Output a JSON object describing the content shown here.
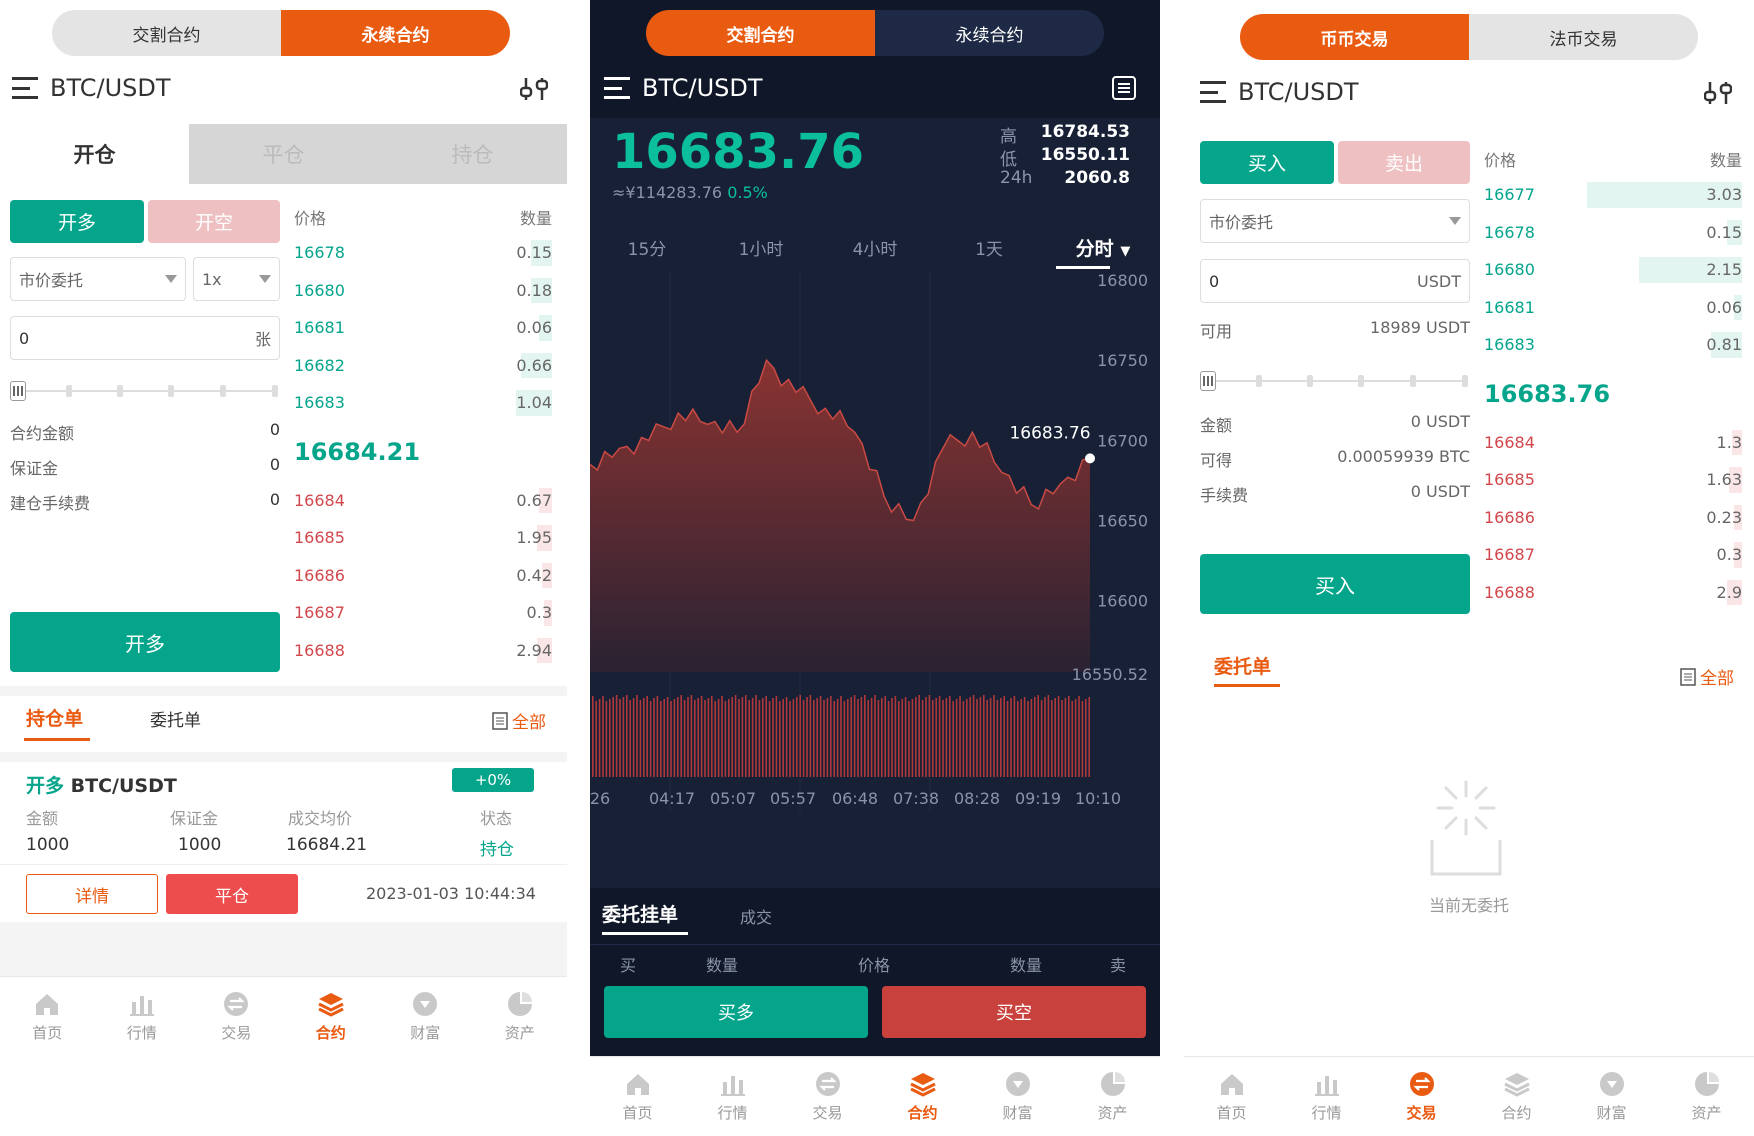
{
  "colors": {
    "accent": "#ea5b12",
    "buy": "#05a58c",
    "sell": "#d2474b",
    "sell_light": "#eec0c2",
    "dark_bg": "#172035",
    "dark_header": "#0f1728"
  },
  "p1": {
    "seg": [
      "交割合约",
      "永续合约"
    ],
    "pair": "BTC/USDT",
    "tabs": [
      "开仓",
      "平仓",
      "持仓"
    ],
    "side": [
      "开多",
      "开空"
    ],
    "order_type": "市价委托",
    "leverage": "1x",
    "qty_value": "0",
    "qty_unit": "张",
    "fields": [
      {
        "k": "合约金额",
        "v": "0"
      },
      {
        "k": "保证金",
        "v": "0"
      },
      {
        "k": "建仓手续费",
        "v": "0"
      }
    ],
    "main_btn": "开多",
    "ob_head": [
      "价格",
      "数量"
    ],
    "asks": [
      {
        "p": "16678",
        "q": "0.15",
        "d": 0.08
      },
      {
        "p": "16680",
        "q": "0.18",
        "d": 0.08
      },
      {
        "p": "16681",
        "q": "0.06",
        "d": 0.05
      },
      {
        "p": "16682",
        "q": "0.66",
        "d": 0.12
      },
      {
        "p": "16683",
        "q": "1.04",
        "d": 0.14
      }
    ],
    "last": "16684.21",
    "bids": [
      {
        "p": "16684",
        "q": "0.67",
        "d": 0.05
      },
      {
        "p": "16685",
        "q": "1.95",
        "d": 0.06
      },
      {
        "p": "16686",
        "q": "0.42",
        "d": 0.04
      },
      {
        "p": "16687",
        "q": "0.3",
        "d": 0.03
      },
      {
        "p": "16688",
        "q": "2.94",
        "d": 0.06
      }
    ],
    "list_tabs": [
      "持仓单",
      "委托单"
    ],
    "all": "全部",
    "pos": {
      "title_side": "开多",
      "title_pair": "BTC/USDT",
      "badge": "+0%",
      "heads": [
        "金额",
        "保证金",
        "成交均价",
        "状态"
      ],
      "vals": [
        "1000",
        "1000",
        "16684.21",
        "持仓"
      ],
      "btn_detail": "详情",
      "btn_close": "平仓",
      "time": "2023-01-03 10:44:34"
    }
  },
  "p2": {
    "seg": [
      "交割合约",
      "永续合约"
    ],
    "pair": "BTC/USDT",
    "price": "16683.76",
    "cny": "≈¥114283.76",
    "pct": "0.5%",
    "stats": [
      {
        "k": "高",
        "v": "16784.53"
      },
      {
        "k": "低",
        "v": "16550.11"
      },
      {
        "k": "24h",
        "v": "2060.8"
      }
    ],
    "intervals": [
      "15分",
      "1小时",
      "4小时",
      "1天",
      "分时"
    ],
    "y_labels": [
      "16800",
      "16750",
      "16700",
      "16650",
      "16600",
      "16550.52"
    ],
    "x_labels": [
      "26",
      "04:17",
      "05:07",
      "05:57",
      "06:48",
      "07:38",
      "08:28",
      "09:19",
      "10:10"
    ],
    "last_label": "16683.76",
    "tabs": [
      "委托挂单",
      "成交"
    ],
    "heads": [
      "买",
      "数量",
      "价格",
      "数量",
      "卖"
    ],
    "btns": [
      "买多",
      "买空"
    ]
  },
  "p3": {
    "seg": [
      "币币交易",
      "法币交易"
    ],
    "pair": "BTC/USDT",
    "side": [
      "买入",
      "卖出"
    ],
    "order_type": "市价委托",
    "amt_value": "0",
    "amt_unit": "USDT",
    "avail_k": "可用",
    "avail_v": "18989 USDT",
    "fields": [
      {
        "k": "金额",
        "v": "0 USDT"
      },
      {
        "k": "可得",
        "v": "0.00059939 BTC"
      },
      {
        "k": "手续费",
        "v": "0 USDT"
      }
    ],
    "main_btn": "买入",
    "ob_head": [
      "价格",
      "数量"
    ],
    "asks": [
      {
        "p": "16677",
        "q": "3.03",
        "d": 0.6
      },
      {
        "p": "16678",
        "q": "0.15",
        "d": 0.06
      },
      {
        "p": "16680",
        "q": "2.15",
        "d": 0.4
      },
      {
        "p": "16681",
        "q": "0.06",
        "d": 0.03
      },
      {
        "p": "16683",
        "q": "0.81",
        "d": 0.12
      }
    ],
    "last": "16683.76",
    "bids": [
      {
        "p": "16684",
        "q": "1.3",
        "d": 0.04
      },
      {
        "p": "16685",
        "q": "1.63",
        "d": 0.05
      },
      {
        "p": "16686",
        "q": "0.23",
        "d": 0.03
      },
      {
        "p": "16687",
        "q": "0.3",
        "d": 0.03
      },
      {
        "p": "16688",
        "q": "2.9",
        "d": 0.06
      }
    ],
    "list_tab": "委托单",
    "all": "全部",
    "empty": "当前无委托"
  },
  "nav": [
    "首页",
    "行情",
    "交易",
    "合约",
    "财富",
    "资产"
  ],
  "chart_data": {
    "type": "area",
    "x": [
      "26",
      "04:17",
      "05:07",
      "05:57",
      "06:48",
      "07:38",
      "08:28",
      "09:19",
      "10:10"
    ],
    "ylim": [
      16550.52,
      16800
    ],
    "series": [
      {
        "values": [
          16680,
          16690,
          16695,
          16712,
          16705,
          16700,
          16745,
          16725,
          16715,
          16700,
          16660,
          16645,
          16690,
          16700,
          16675,
          16655,
          16668,
          16683.76
        ]
      }
    ]
  }
}
